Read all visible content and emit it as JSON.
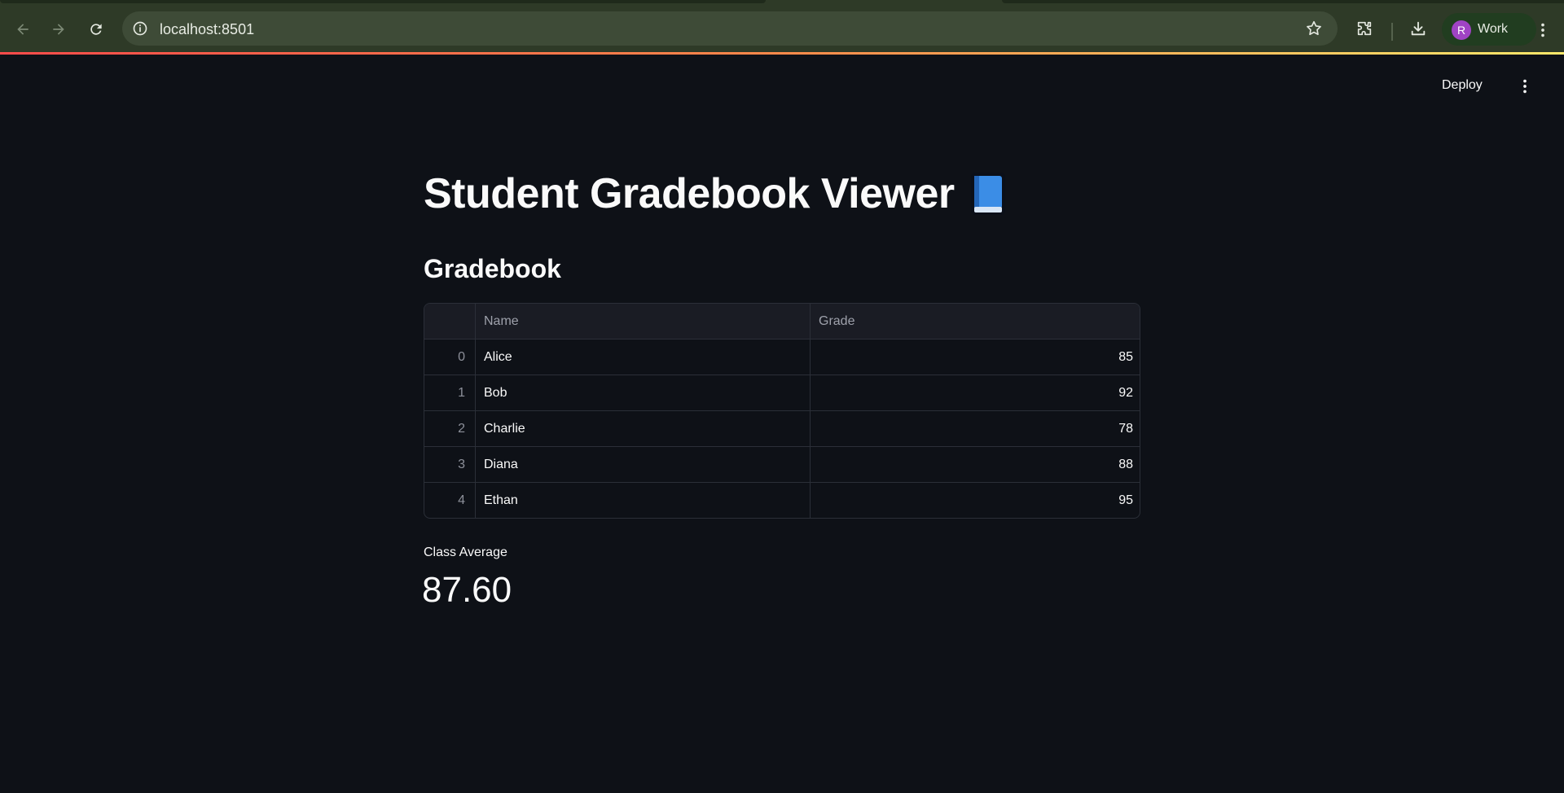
{
  "browser": {
    "url": "localhost:8501",
    "profile_initial": "R",
    "profile_label": "Work"
  },
  "app_header": {
    "deploy_label": "Deploy"
  },
  "main": {
    "title": "Student Gradebook Viewer",
    "title_icon": "blue-book-icon",
    "subheader": "Gradebook",
    "table": {
      "columns": [
        "",
        "Name",
        "Grade"
      ],
      "rows": [
        {
          "index": "0",
          "name": "Alice",
          "grade": "85"
        },
        {
          "index": "1",
          "name": "Bob",
          "grade": "92"
        },
        {
          "index": "2",
          "name": "Charlie",
          "grade": "78"
        },
        {
          "index": "3",
          "name": "Diana",
          "grade": "88"
        },
        {
          "index": "4",
          "name": "Ethan",
          "grade": "95"
        }
      ]
    },
    "metric": {
      "label": "Class Average",
      "value": "87.60"
    }
  },
  "colors": {
    "background": "#0e1117",
    "text": "#fafafa",
    "accent_gradient_start": "#ff4b4b",
    "accent_gradient_end": "#ffe96b"
  }
}
